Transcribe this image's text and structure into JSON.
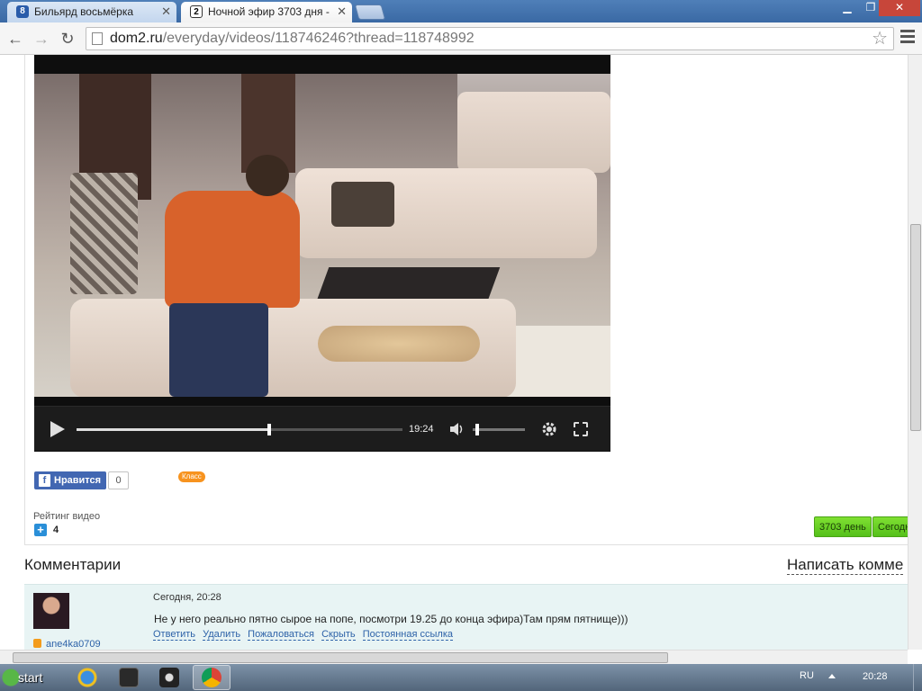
{
  "browser": {
    "tabs": [
      {
        "title": "Бильярд восьмёрка",
        "active": false
      },
      {
        "title": "Ночной эфир 3703 дня -",
        "active": true
      }
    ],
    "url_host": "dom2.ru",
    "url_path": "/everyday/videos/118746246?thread=118748992"
  },
  "player": {
    "time": "19:24",
    "progress_fraction": 0.59,
    "volume_fraction": 0.05
  },
  "social": {
    "like_label": "Нравится",
    "like_count": "0",
    "ok_label": "Класс"
  },
  "rating": {
    "label": "Рейтинг видео",
    "value": "4"
  },
  "day_nav": {
    "day_label": "3703 день",
    "today_label": "Сегодн"
  },
  "comments": {
    "title": "Комментарии",
    "write_label": "Написать комме",
    "items": [
      {
        "date": "Сегодня, 20:28",
        "text": "Не у него реально пятно сырое на попе, посмотри 19.25 до конца эфира)Там прям пятнище)))",
        "user": "ane4ka0709",
        "actions": [
          "Ответить",
          "Удалить",
          "Пожаловаться",
          "Скрыть",
          "Постоянная ссылка"
        ]
      }
    ]
  },
  "taskbar": {
    "start_label": "start",
    "lang": "RU",
    "time": "20:28"
  },
  "colors": {
    "accent_green": "#55c01a",
    "link_blue": "#2d62a8",
    "facebook_blue": "#4267b2",
    "ok_orange": "#f7931e"
  }
}
